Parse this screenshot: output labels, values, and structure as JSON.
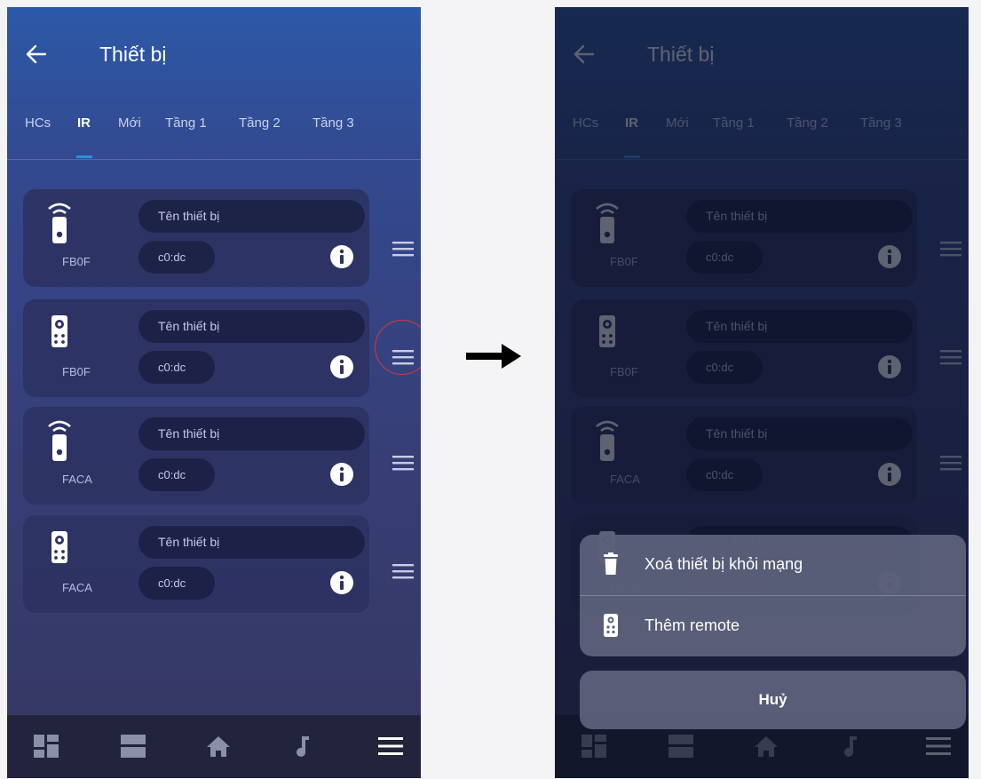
{
  "screen": {
    "title": "Thiết bị",
    "tabs": [
      {
        "label": "HCs",
        "active": false
      },
      {
        "label": "IR",
        "active": true
      },
      {
        "label": "Mới",
        "active": false
      },
      {
        "label": "Tầng 1",
        "active": false
      },
      {
        "label": "Tầng 2",
        "active": false
      },
      {
        "label": "Tầng 3",
        "active": false
      }
    ],
    "devices": [
      {
        "icon": "ir-remote-icon",
        "code": "FB0F",
        "name_placeholder": "Tên thiết bị",
        "mac": "c0:dc"
      },
      {
        "icon": "remote-control-icon",
        "code": "FB0F",
        "name_placeholder": "Tên thiết bị",
        "mac": "c0:dc"
      },
      {
        "icon": "ir-remote-icon",
        "code": "FACA",
        "name_placeholder": "Tên thiết bị",
        "mac": "c0:dc"
      },
      {
        "icon": "remote-control-icon",
        "code": "FACA",
        "name_placeholder": "Tên thiết bị",
        "mac": "c0:dc"
      }
    ],
    "bottom_nav": [
      "dashboard-icon",
      "rooms-icon",
      "home-icon",
      "music-icon",
      "menu-icon"
    ]
  },
  "action_sheet": {
    "items": [
      {
        "icon": "trash-icon",
        "label": "Xoá thiết bị khỏi mạng"
      },
      {
        "icon": "remote-control-icon",
        "label": "Thêm remote"
      }
    ],
    "cancel_label": "Huỷ"
  },
  "colors": {
    "accent": "#2e8fe6",
    "highlight": "#d53b3b",
    "header_blue": "#2c59a8",
    "background_bottom": "#363760",
    "card": "#2c3262",
    "nav_bar": "#21243a",
    "sheet": "#5c607a"
  }
}
